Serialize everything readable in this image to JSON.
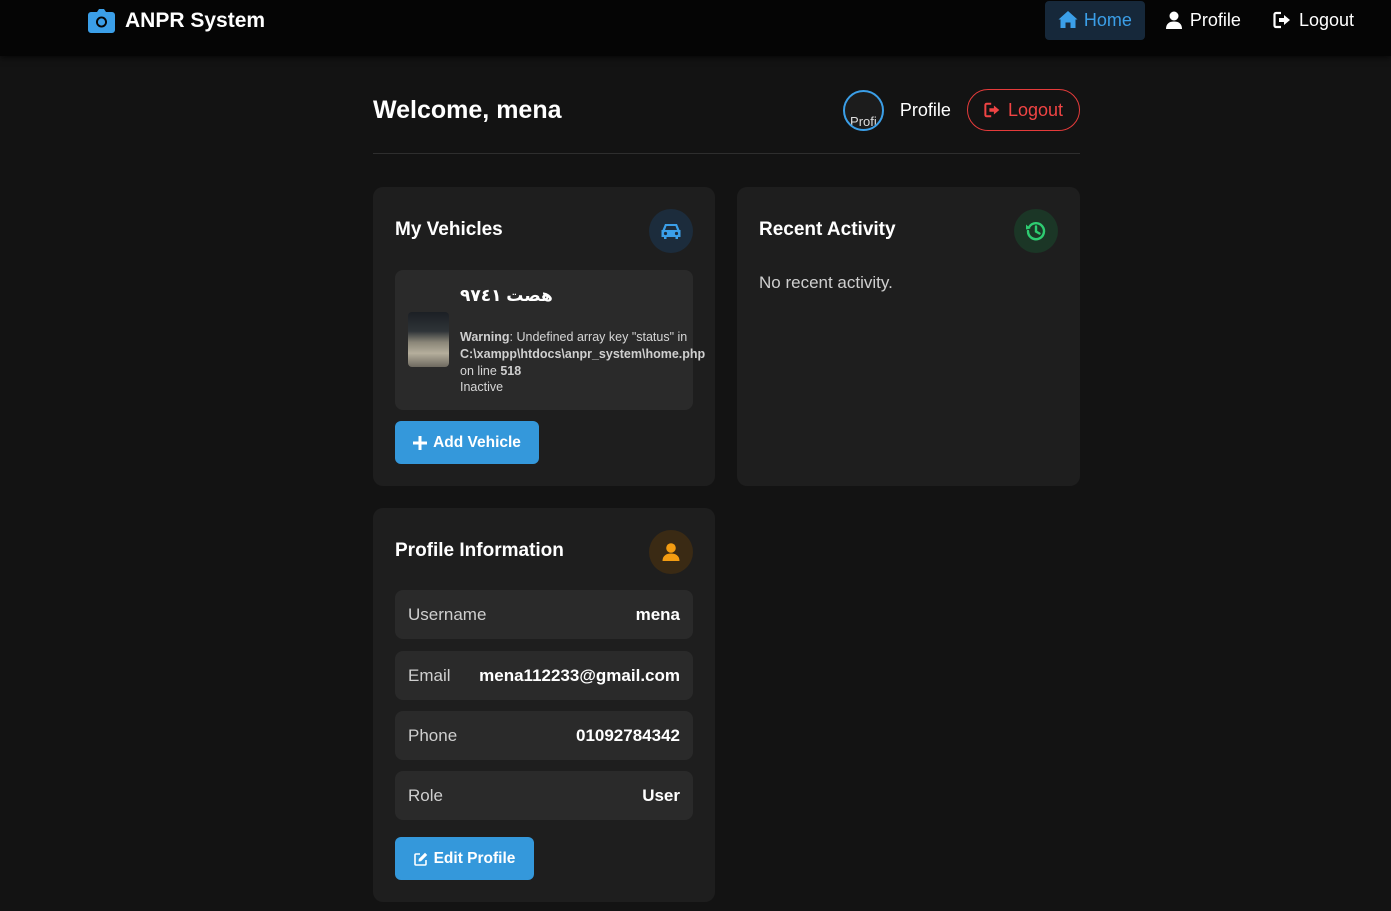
{
  "navbar": {
    "brand": "ANPR System",
    "links": [
      {
        "label": "Home"
      },
      {
        "label": "Profile"
      },
      {
        "label": "Logout"
      }
    ]
  },
  "header": {
    "welcome": "Welcome, mena",
    "avatar_alt": "Profi",
    "profile_label": "Profile",
    "logout_label": "Logout"
  },
  "vehicles": {
    "title": "My Vehicles",
    "items": [
      {
        "plate": "هصت ٩٧٤١",
        "warning_label": "Warning",
        "warning_text": ": Undefined array key \"status\" in",
        "warning_path": "C:\\xampp\\htdocs\\anpr_system\\home.php",
        "warning_line_prefix": "on line ",
        "warning_line": "518",
        "status": "Inactive"
      }
    ],
    "add_label": "Add Vehicle"
  },
  "activity": {
    "title": "Recent Activity",
    "empty": "No recent activity."
  },
  "profile": {
    "title": "Profile Information",
    "rows": [
      {
        "label": "Username",
        "value": "mena"
      },
      {
        "label": "Email",
        "value": "mena112233@gmail.com"
      },
      {
        "label": "Phone",
        "value": "01092784342"
      },
      {
        "label": "Role",
        "value": "User"
      }
    ],
    "edit_label": "Edit Profile"
  },
  "colors": {
    "accent": "#3498db",
    "danger": "#e53b3b",
    "vehicle_icon": "#3b9fe8",
    "activity_icon": "#2ecc71",
    "profile_icon": "#f39c12"
  }
}
